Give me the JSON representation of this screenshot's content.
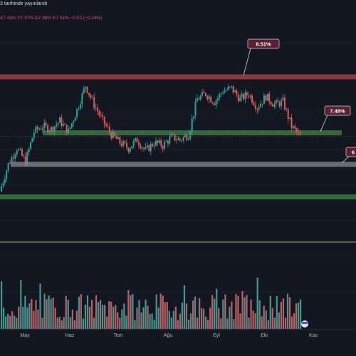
{
  "header": {
    "published_text": "3 tarihinde yayınlandı",
    "ohlc_text": "A7.43% Y7.47% D7.39% K7.41% −0.02 (−0.24%)"
  },
  "chart_data": {
    "type": "candlestick",
    "x_tick_labels": [
      "May",
      "Haz",
      "Tem",
      "Ağu",
      "Eyl",
      "Eki",
      "Kas"
    ],
    "y_range": [
      5.6,
      9.4
    ],
    "levels": [
      {
        "name": "resistance",
        "value": 8.51,
        "color": "#ef5350",
        "label": "8.51%"
      },
      {
        "name": "support-1",
        "value": 7.48,
        "color": "#4caf50",
        "label": "7.48%"
      },
      {
        "name": "support-2",
        "value": 6.9,
        "color": "#b2b5be",
        "label": "6"
      },
      {
        "name": "support-3",
        "value": 6.3,
        "color": "#4caf50",
        "label": ""
      }
    ],
    "current_price_line": 7.41,
    "up_color": "#26a69a",
    "down_color": "#ef5350",
    "weekly_closes": [
      6.4,
      6.9,
      7.2,
      6.95,
      7.5,
      7.6,
      7.55,
      7.7,
      7.5,
      7.9,
      8.35,
      8.0,
      7.7,
      7.45,
      7.3,
      7.2,
      7.35,
      7.15,
      7.3,
      7.25,
      7.4,
      7.35,
      7.45,
      8.1,
      8.2,
      8.05,
      8.25,
      8.3,
      8.1,
      8.2,
      7.95,
      8.15,
      8.0,
      8.05,
      7.6,
      7.41
    ],
    "volume_bars": 140
  },
  "colors": {
    "background": "#131722",
    "grid_line": "#1e222d",
    "baseline": "#c8a04a"
  }
}
